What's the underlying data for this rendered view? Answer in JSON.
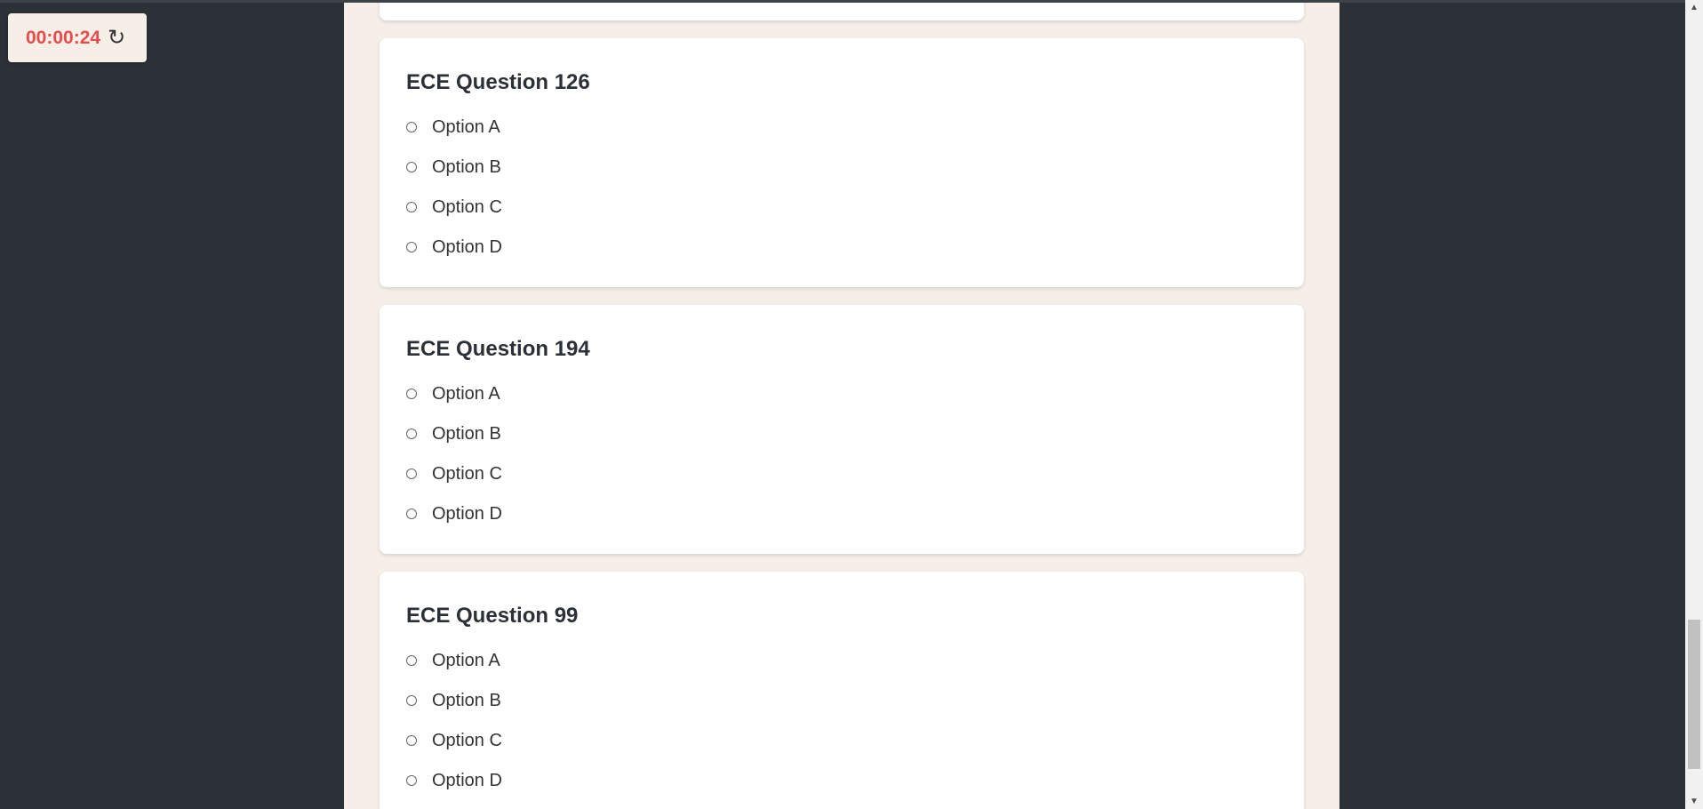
{
  "timer": {
    "value": "00:00:24",
    "reset_icon": "↻"
  },
  "questions": [
    {
      "title": "ECE Question 126",
      "options": [
        "Option A",
        "Option B",
        "Option C",
        "Option D"
      ]
    },
    {
      "title": "ECE Question 194",
      "options": [
        "Option A",
        "Option B",
        "Option C",
        "Option D"
      ]
    },
    {
      "title": "ECE Question 99",
      "options": [
        "Option A",
        "Option B",
        "Option C",
        "Option D"
      ]
    }
  ],
  "colors": {
    "background": "#2b3137",
    "panel": "#f5efe8",
    "card": "#ffffff",
    "timer_text": "#e84b4b"
  },
  "scrollbar": {
    "up_icon": "▲",
    "down_icon": "▼"
  }
}
